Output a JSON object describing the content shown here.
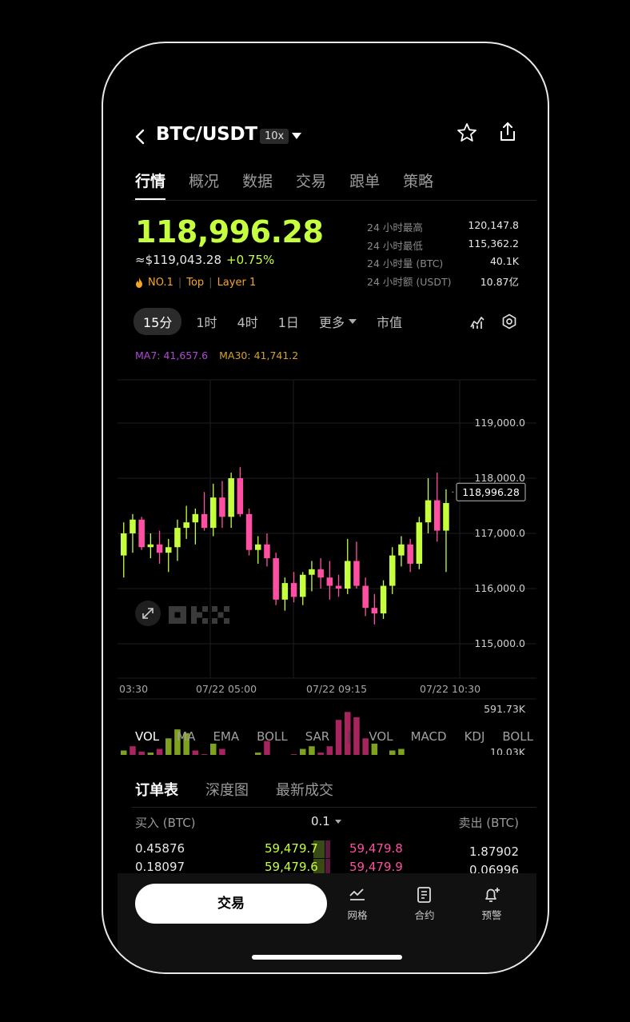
{
  "header": {
    "pair": "BTC/USDT",
    "leverage": "10x"
  },
  "tabs": [
    {
      "label": "行情",
      "active": true
    },
    {
      "label": "概况"
    },
    {
      "label": "数据"
    },
    {
      "label": "交易"
    },
    {
      "label": "跟单"
    },
    {
      "label": "策略"
    }
  ],
  "price": {
    "last": "118,996.28",
    "usd": "≈$119,043.28",
    "change": "+0.75%",
    "rank": "NO.1",
    "tag1": "Top",
    "tag2": "Layer 1"
  },
  "stats": [
    {
      "label": "24 小时最高",
      "value": "120,147.8"
    },
    {
      "label": "24 小时最低",
      "value": "115,362.2"
    },
    {
      "label": "24 小时量 (BTC)",
      "value": "40.1K"
    },
    {
      "label": "24 小时额 (USDT)",
      "value": "10.87亿"
    }
  ],
  "intervals": {
    "items": [
      "15分",
      "1时",
      "4时",
      "1日"
    ],
    "more": "更多",
    "market_cap": "市值"
  },
  "ma": {
    "ma7": "MA7: 41,657.6",
    "ma30": "MA30: 41,741.2"
  },
  "chart_data": {
    "type": "candlestick",
    "price_ticks": [
      "119,000.0",
      "118,000.0",
      "117,000.0",
      "116,000.0",
      "115,000.0"
    ],
    "current_price_label": "118,996.28",
    "time_ticks": [
      "03:30",
      "07/22 05:00",
      "07/22 09:15",
      "07/22 10:30"
    ],
    "volume_ticks": [
      "591.73K",
      "10.03K"
    ],
    "colors": {
      "up": "#c5ff3e",
      "down": "#ff4fa3",
      "vol_up": "#7fa21e",
      "vol_down": "#a8245f"
    },
    "candles": [
      {
        "o": 116600,
        "h": 117200,
        "l": 116200,
        "c": 117000
      },
      {
        "o": 117000,
        "h": 117350,
        "l": 116650,
        "c": 117250
      },
      {
        "o": 117250,
        "h": 117300,
        "l": 116700,
        "c": 116750
      },
      {
        "o": 116750,
        "h": 117000,
        "l": 116550,
        "c": 116800
      },
      {
        "o": 116800,
        "h": 117050,
        "l": 116450,
        "c": 116650
      },
      {
        "o": 116650,
        "h": 116900,
        "l": 116300,
        "c": 116750
      },
      {
        "o": 116750,
        "h": 117250,
        "l": 116500,
        "c": 117100
      },
      {
        "o": 117100,
        "h": 117500,
        "l": 116900,
        "c": 117200
      },
      {
        "o": 117200,
        "h": 117450,
        "l": 116800,
        "c": 117350
      },
      {
        "o": 117350,
        "h": 117750,
        "l": 117050,
        "c": 117100
      },
      {
        "o": 117100,
        "h": 117900,
        "l": 116950,
        "c": 117650
      },
      {
        "o": 117650,
        "h": 117950,
        "l": 117100,
        "c": 117300
      },
      {
        "o": 117300,
        "h": 118100,
        "l": 117100,
        "c": 118000
      },
      {
        "o": 118000,
        "h": 118200,
        "l": 117300,
        "c": 117350
      },
      {
        "o": 117350,
        "h": 117450,
        "l": 116600,
        "c": 116700
      },
      {
        "o": 116700,
        "h": 116950,
        "l": 116450,
        "c": 116800
      },
      {
        "o": 116800,
        "h": 117000,
        "l": 116400,
        "c": 116550
      },
      {
        "o": 116550,
        "h": 116650,
        "l": 115700,
        "c": 115800
      },
      {
        "o": 115800,
        "h": 116200,
        "l": 115600,
        "c": 116100
      },
      {
        "o": 116100,
        "h": 116300,
        "l": 115750,
        "c": 115850
      },
      {
        "o": 115850,
        "h": 116300,
        "l": 115700,
        "c": 116250
      },
      {
        "o": 116250,
        "h": 116500,
        "l": 115950,
        "c": 116350
      },
      {
        "o": 116350,
        "h": 116550,
        "l": 116000,
        "c": 116200
      },
      {
        "o": 116200,
        "h": 116500,
        "l": 115800,
        "c": 116050
      },
      {
        "o": 116050,
        "h": 116250,
        "l": 115850,
        "c": 116000
      },
      {
        "o": 116000,
        "h": 116900,
        "l": 115900,
        "c": 116500
      },
      {
        "o": 116500,
        "h": 116850,
        "l": 116000,
        "c": 116050
      },
      {
        "o": 116050,
        "h": 116200,
        "l": 115500,
        "c": 115650
      },
      {
        "o": 115650,
        "h": 115900,
        "l": 115350,
        "c": 115550
      },
      {
        "o": 115550,
        "h": 116150,
        "l": 115450,
        "c": 116050
      },
      {
        "o": 116050,
        "h": 116750,
        "l": 115900,
        "c": 116600
      },
      {
        "o": 116600,
        "h": 116950,
        "l": 116400,
        "c": 116800
      },
      {
        "o": 116800,
        "h": 116900,
        "l": 116300,
        "c": 116450
      },
      {
        "o": 116450,
        "h": 117300,
        "l": 116350,
        "c": 117200
      },
      {
        "o": 117200,
        "h": 118000,
        "l": 117000,
        "c": 117600
      },
      {
        "o": 117600,
        "h": 118100,
        "l": 116850,
        "c": 117050
      },
      {
        "o": 117050,
        "h": 117800,
        "l": 116300,
        "c": 117550
      }
    ],
    "volumes": [
      0.22,
      0.3,
      0.2,
      0.18,
      0.25,
      0.45,
      0.62,
      0.55,
      0.22,
      0.15,
      0.35,
      0.25,
      0.12,
      0.08,
      0.06,
      0.18,
      0.4,
      0.1,
      0.08,
      0.15,
      0.25,
      0.3,
      0.18,
      0.3,
      0.8,
      0.95,
      0.85,
      0.45,
      0.35,
      0.12,
      0.22,
      0.25,
      0.12,
      0.1,
      0.08,
      0.1,
      0.08
    ],
    "vol_up": [
      true,
      false,
      false,
      true,
      false,
      true,
      true,
      true,
      false,
      false,
      true,
      false,
      true,
      false,
      false,
      true,
      false,
      false,
      true,
      false,
      true,
      true,
      false,
      false,
      false,
      false,
      false,
      false,
      true,
      false,
      true,
      true,
      false,
      true,
      true,
      false,
      true
    ]
  },
  "indicator_tabs": [
    "VOL",
    "MA",
    "EMA",
    "BOLL",
    "SAR",
    "VOL",
    "MACD",
    "KDJ",
    "BOLL"
  ],
  "orderbook": {
    "tabs": [
      "订单表",
      "深度图",
      "最新成交"
    ],
    "bid_header": "买入 (BTC)",
    "precision": "0.1",
    "ask_header": "卖出 (BTC)",
    "rows": [
      {
        "bid_qty": "0.45876",
        "bid_price": "59,479.7",
        "ask_price": "59,479.8",
        "ask_qty": "1.87902"
      },
      {
        "bid_qty": "0.18097",
        "bid_price": "59,479.6",
        "ask_price": "59,479.9",
        "ask_qty": "0.06996"
      }
    ]
  },
  "bottom": {
    "trade": "交易",
    "grid": "网格",
    "contract": "合约",
    "alert": "预警"
  }
}
